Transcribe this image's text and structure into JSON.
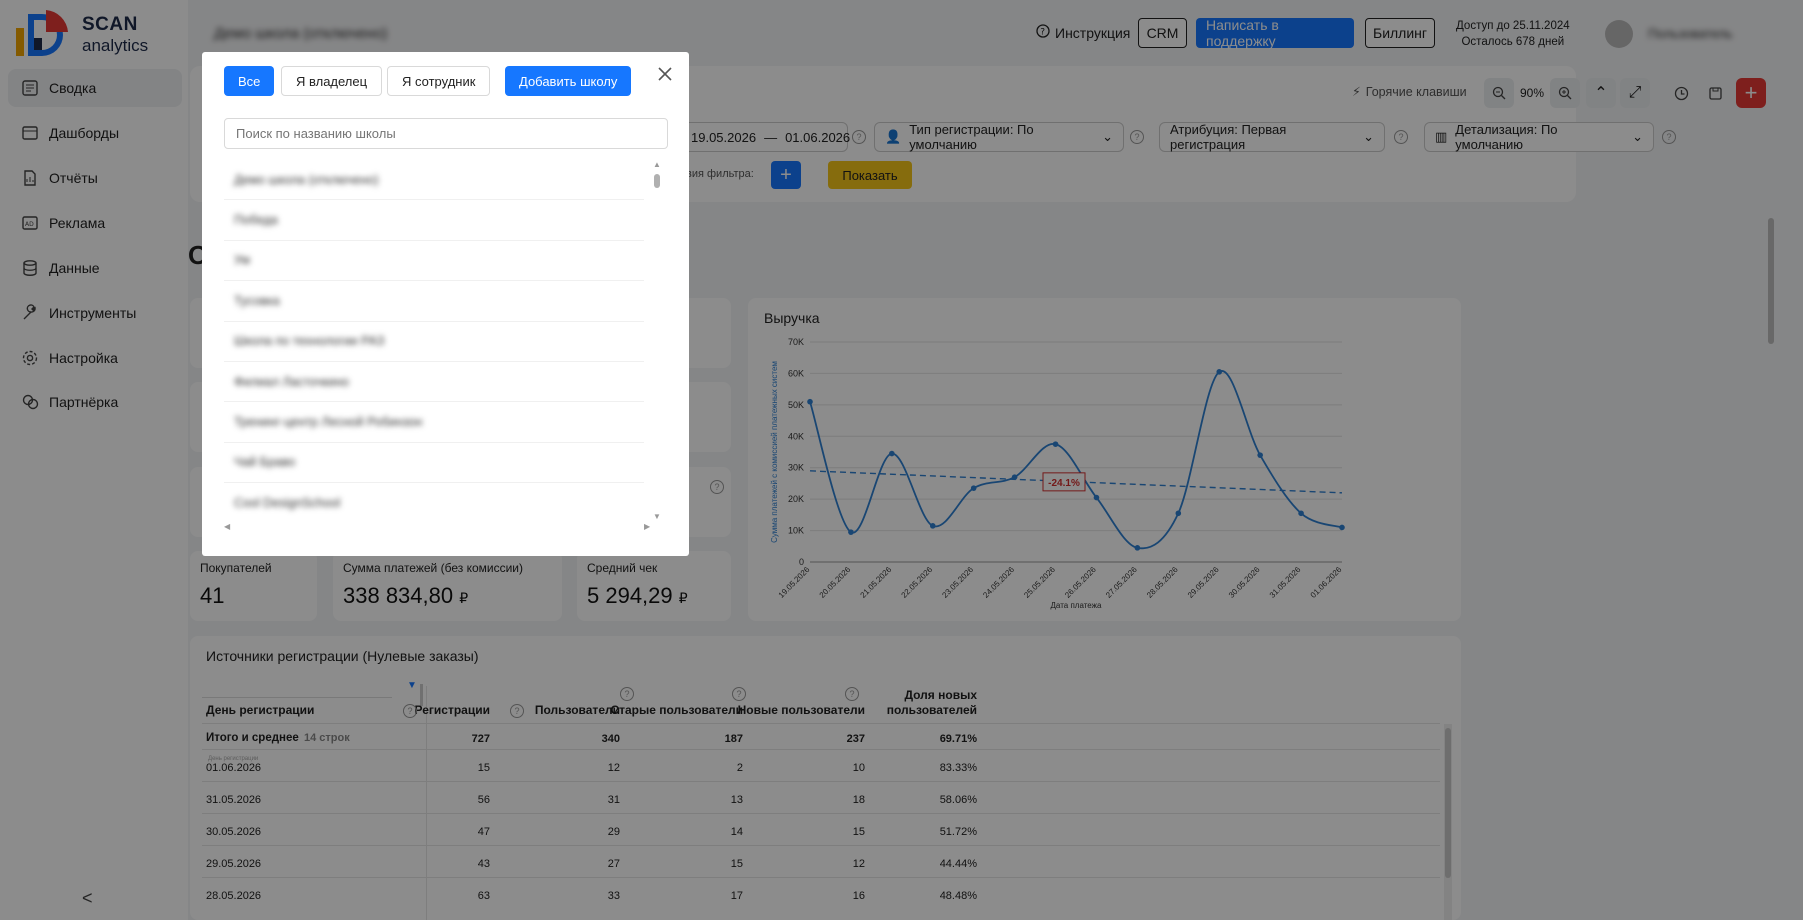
{
  "brand": {
    "name_top": "SCAN",
    "name_bottom": "analytics"
  },
  "sidebar": {
    "items": [
      {
        "label": "Сводка",
        "icon": "summary-icon",
        "active": true
      },
      {
        "label": "Дашборды",
        "icon": "dashboard-icon"
      },
      {
        "label": "Отчёты",
        "icon": "reports-icon"
      },
      {
        "label": "Реклама",
        "icon": "ads-icon"
      },
      {
        "label": "Данные",
        "icon": "database-icon"
      },
      {
        "label": "Инструменты",
        "icon": "tools-icon"
      },
      {
        "label": "Настройка",
        "icon": "settings-icon"
      },
      {
        "label": "Партнёрка",
        "icon": "partners-icon"
      }
    ],
    "collapse_glyph": "<"
  },
  "header": {
    "school_name": "Демо школа (отключено)",
    "instruction": "Инструкция",
    "crm": "CRM",
    "support": "Написать в поддержку",
    "billing": "Биллинг",
    "access_line1": "Доступ до 25.11.2024",
    "access_line2": "Осталось 678 дней",
    "user_name": "Пользователь"
  },
  "toolbar": {
    "hotkeys": "Горячие клавиши",
    "zoom": "90%"
  },
  "filters": {
    "date_from": "19.05.2026",
    "date_sep": "—",
    "date_to": "01.06.2026",
    "reg_type": "Тип регистрации: По умолчанию",
    "attribution": "Атрибуция: Первая регистрация",
    "detail": "Детализация:  По умолчанию",
    "condition_label": "вия фильтра:",
    "show": "Показать"
  },
  "page_title_fragment": "О",
  "cards": {
    "buyers": {
      "label": "Покупателей",
      "value": "41"
    },
    "sum": {
      "label": "Сумма платежей (без комиссии)",
      "value": "338 834,80",
      "unit": "₽"
    },
    "avg": {
      "label": "Средний чек",
      "value": "5 294,29",
      "unit": "₽"
    }
  },
  "chart_data": {
    "type": "line",
    "title": "Выручка",
    "xlabel": "Дата платежа",
    "ylabel": "Сумма платежей с комиссией платежных систем",
    "ylim": [
      0,
      70000
    ],
    "yticks": [
      "0",
      "10K",
      "20K",
      "30K",
      "40K",
      "50K",
      "60K",
      "70K"
    ],
    "categories": [
      "19.05.2026",
      "20.05.2026",
      "21.05.2026",
      "22.05.2026",
      "23.05.2026",
      "24.05.2026",
      "25.05.2026",
      "26.05.2026",
      "27.05.2026",
      "28.05.2026",
      "29.05.2026",
      "30.05.2026",
      "31.05.2026",
      "01.06.2026"
    ],
    "values": [
      51000,
      9500,
      34500,
      11500,
      23500,
      27000,
      37500,
      20500,
      4500,
      15500,
      60500,
      34000,
      15500,
      11000
    ],
    "trend": {
      "start": 29000,
      "end": 22000,
      "label": "-24.1%"
    },
    "color": "#2f80d1",
    "grid": true
  },
  "table": {
    "title": "Источники регистрации (Нулевые заказы)",
    "col_first": "День регистрации",
    "columns": [
      "Регистрации",
      "Пользователи",
      "Старые пользователи",
      "Новые пользователи",
      "Доля новых пользователей"
    ],
    "total_label": "Итого и среднее",
    "total_count": "14 строк",
    "totals": [
      "727",
      "340",
      "187",
      "237",
      "69.71%"
    ],
    "row_hint": "День регистрации",
    "rows": [
      {
        "date": "01.06.2026",
        "v": [
          "15",
          "12",
          "2",
          "10",
          "83.33%"
        ]
      },
      {
        "date": "31.05.2026",
        "v": [
          "56",
          "31",
          "13",
          "18",
          "58.06%"
        ]
      },
      {
        "date": "30.05.2026",
        "v": [
          "47",
          "29",
          "14",
          "15",
          "51.72%"
        ]
      },
      {
        "date": "29.05.2026",
        "v": [
          "43",
          "27",
          "15",
          "12",
          "44.44%"
        ]
      },
      {
        "date": "28.05.2026",
        "v": [
          "63",
          "33",
          "17",
          "16",
          "48.48%"
        ]
      }
    ]
  },
  "modal": {
    "tab_all": "Все",
    "tab_owner": "Я владелец",
    "tab_employee": "Я сотрудник",
    "add_school": "Добавить школу",
    "search_placeholder": "Поиск по названию школы",
    "schools": [
      "Демо школа (отключено)",
      "Победа",
      "Ум",
      "Тусовка",
      "Школа по технологии РАЗ",
      "Филиал Ласточкино",
      "Тренинг-центр Лесной Робинзон",
      "Чай Браво",
      "Cool DesignSchool"
    ]
  }
}
